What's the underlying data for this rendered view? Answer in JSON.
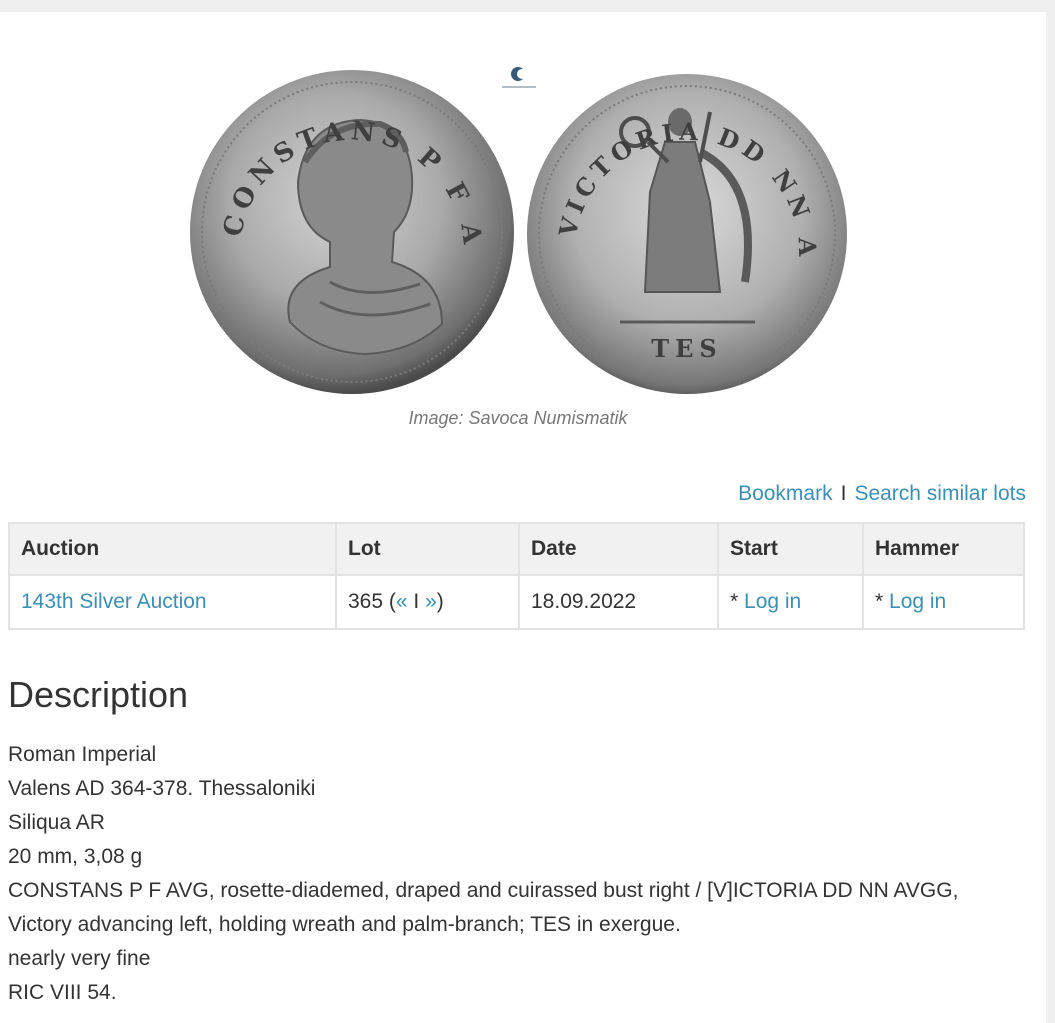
{
  "image": {
    "logo_icon": "savoca-logo-icon",
    "caption": "Image: Savoca Numismatik",
    "obverse_legend": "CONSTANS P F AVG",
    "reverse_legend": "VICTORIA DD NN AVGG",
    "exergue": "TES"
  },
  "actions": {
    "bookmark": "Bookmark",
    "separator": "I",
    "search_similar": "Search similar lots"
  },
  "table": {
    "headers": [
      "Auction",
      "Lot",
      "Date",
      "Start",
      "Hammer"
    ],
    "row": {
      "auction": "143th Silver Auction",
      "lot_number": "365",
      "lot_open": " (",
      "prev": "«",
      "nav_sep": " I ",
      "next": "»",
      "lot_close": ")",
      "date": "18.09.2022",
      "start_prefix": "* ",
      "start_link": "Log in",
      "hammer_prefix": "* ",
      "hammer_link": "Log in"
    }
  },
  "description": {
    "heading": "Description",
    "lines": [
      "Roman Imperial",
      "Valens AD 364-378. Thessaloniki",
      "Siliqua AR",
      "20 mm, 3,08 g",
      "CONSTANS P F AVG, rosette-diademed, draped and cuirassed bust right / [V]ICTORIA DD NN AVGG,",
      "Victory advancing left, holding wreath and palm-branch; TES in exergue.",
      "nearly very fine",
      "RIC VIII 54."
    ]
  }
}
